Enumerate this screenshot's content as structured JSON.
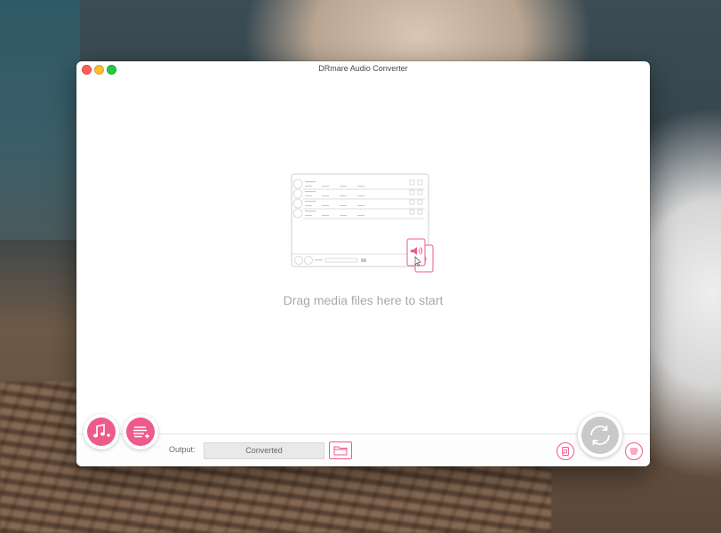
{
  "window": {
    "title": "DRmare Audio Converter"
  },
  "main": {
    "drop_hint": "Drag media files here to start"
  },
  "bottom": {
    "output_label": "Output:",
    "output_value": "Converted"
  },
  "icons": {
    "add_music": "music-plus-icon",
    "add_list": "list-plus-icon",
    "browse_folder": "folder-icon",
    "format": "audio-format-icon",
    "convert": "convert-icon",
    "history": "history-list-icon"
  },
  "colors": {
    "accent": "#ee5a89",
    "convert_disabled": "#c9c9c9"
  }
}
